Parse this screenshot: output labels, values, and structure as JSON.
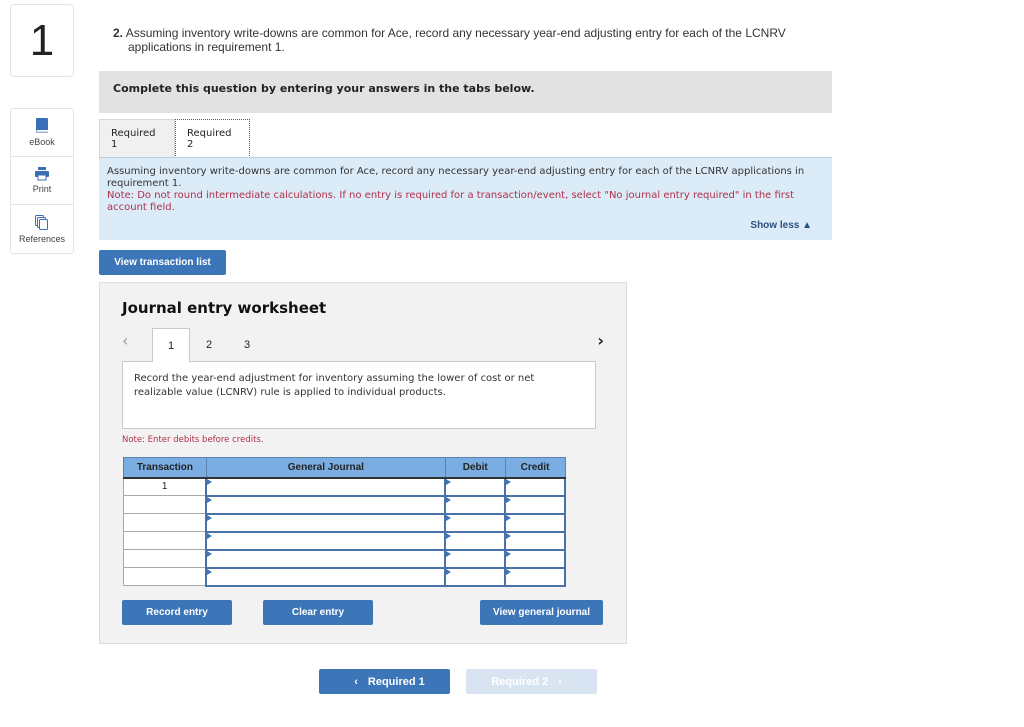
{
  "question": {
    "number": "1",
    "part_label": "2.",
    "text": "Assuming inventory write-downs are common for Ace, record any necessary year-end adjusting entry for each of the LCNRV",
    "text_cont": "applications in requirement 1."
  },
  "sidebar": {
    "items": [
      {
        "label": "eBook",
        "icon": "book-icon"
      },
      {
        "label": "Print",
        "icon": "printer-icon"
      },
      {
        "label": "References",
        "icon": "copy-pages-icon"
      }
    ]
  },
  "complete_banner": "Complete this question by entering your answers in the tabs below.",
  "tabs": [
    {
      "label": "Required 1",
      "active": false
    },
    {
      "label": "Required 2",
      "active": true
    }
  ],
  "instructions": {
    "text": "Assuming inventory write-downs are common for Ace, record any necessary year-end adjusting entry for each of the LCNRV applications in requirement 1.",
    "note": "Note: Do not round intermediate calculations. If no entry is required for a transaction/event, select \"No journal entry required\" in the first account field.",
    "show_less": "Show less"
  },
  "view_transaction_list": "View transaction list",
  "worksheet": {
    "title": "Journal entry worksheet",
    "pages": [
      "1",
      "2",
      "3"
    ],
    "active_page": "1",
    "prev_icon": "‹",
    "next_icon": "›",
    "description": "Record the year-end adjustment for inventory assuming the lower of cost or net realizable value (LCNRV) rule is applied to individual products.",
    "note": "Note: Enter debits before credits.",
    "table": {
      "headers": [
        "Transaction",
        "General Journal",
        "Debit",
        "Credit"
      ],
      "rows": [
        {
          "transaction": "1",
          "account": "",
          "debit": "",
          "credit": ""
        },
        {
          "transaction": "",
          "account": "",
          "debit": "",
          "credit": ""
        },
        {
          "transaction": "",
          "account": "",
          "debit": "",
          "credit": ""
        },
        {
          "transaction": "",
          "account": "",
          "debit": "",
          "credit": ""
        },
        {
          "transaction": "",
          "account": "",
          "debit": "",
          "credit": ""
        },
        {
          "transaction": "",
          "account": "",
          "debit": "",
          "credit": ""
        }
      ]
    },
    "buttons": {
      "record": "Record entry",
      "clear": "Clear entry",
      "view_gj": "View general journal"
    }
  },
  "nav": {
    "prev": "Required 1",
    "next": "Required 2",
    "prev_icon": "‹",
    "next_icon": "›"
  },
  "colors": {
    "primary_button": "#3c76b8",
    "header_blue": "#7aaee3",
    "note_red": "#b0304a",
    "instruction_bg": "#dcebf8"
  }
}
